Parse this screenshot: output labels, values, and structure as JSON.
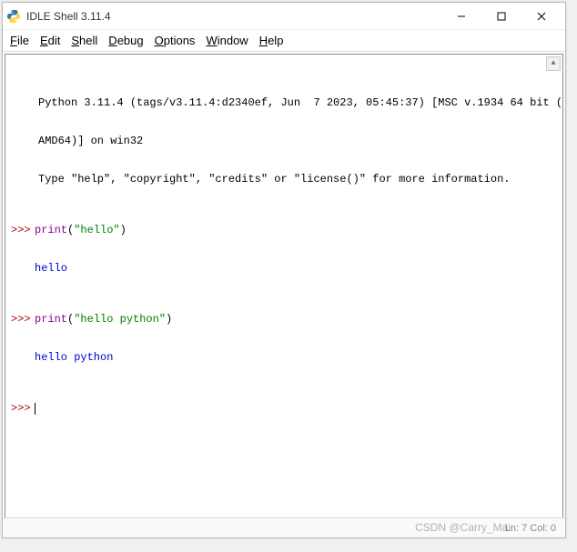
{
  "window": {
    "title": "IDLE Shell 3.11.4"
  },
  "menu": {
    "file": "File",
    "edit": "Edit",
    "shell": "Shell",
    "debug": "Debug",
    "options": "Options",
    "window": "Window",
    "help": "Help"
  },
  "terminal": {
    "banner_line1": "Python 3.11.4 (tags/v3.11.4:d2340ef, Jun  7 2023, 05:45:37) [MSC v.1934 64 bit (",
    "banner_line2": "AMD64)] on win32",
    "banner_line3": "Type \"help\", \"copyright\", \"credits\" or \"license()\" for more information.",
    "prompt": ">>>",
    "cmd1_func": "print",
    "cmd1_open": "(",
    "cmd1_str": "\"hello\"",
    "cmd1_close": ")",
    "out1": "hello",
    "cmd2_func": "print",
    "cmd2_open": "(",
    "cmd2_str": "\"hello python\"",
    "cmd2_close": ")",
    "out2": "hello python"
  },
  "status": {
    "position": "Ln: 7  Col: 0"
  },
  "watermark": "CSDN @Carry_Mai"
}
